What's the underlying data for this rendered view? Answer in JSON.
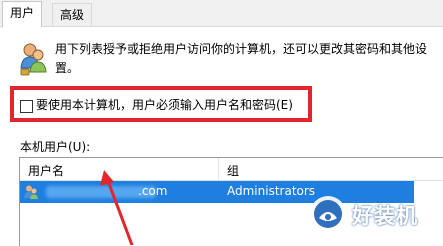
{
  "tabs": [
    {
      "label": "用户",
      "active": true
    },
    {
      "label": "高级",
      "active": false
    }
  ],
  "description": "用下列表授予或拒绝用户访问你的计算机，还可以更改其密码和其他设置。",
  "require_login_checkbox": {
    "label": "要使用本计算机，用户必须输入用户名和密码(E)",
    "checked": false
  },
  "local_users": {
    "section_label": "本机用户(U):",
    "columns": [
      "用户名",
      "组"
    ],
    "rows": [
      {
        "name": "          .com",
        "group": "Administrators",
        "selected": true
      }
    ]
  },
  "watermark": {
    "text": "好装机"
  },
  "colors": {
    "selection": "#1e7fe0",
    "highlight_box": "#e3252c"
  }
}
